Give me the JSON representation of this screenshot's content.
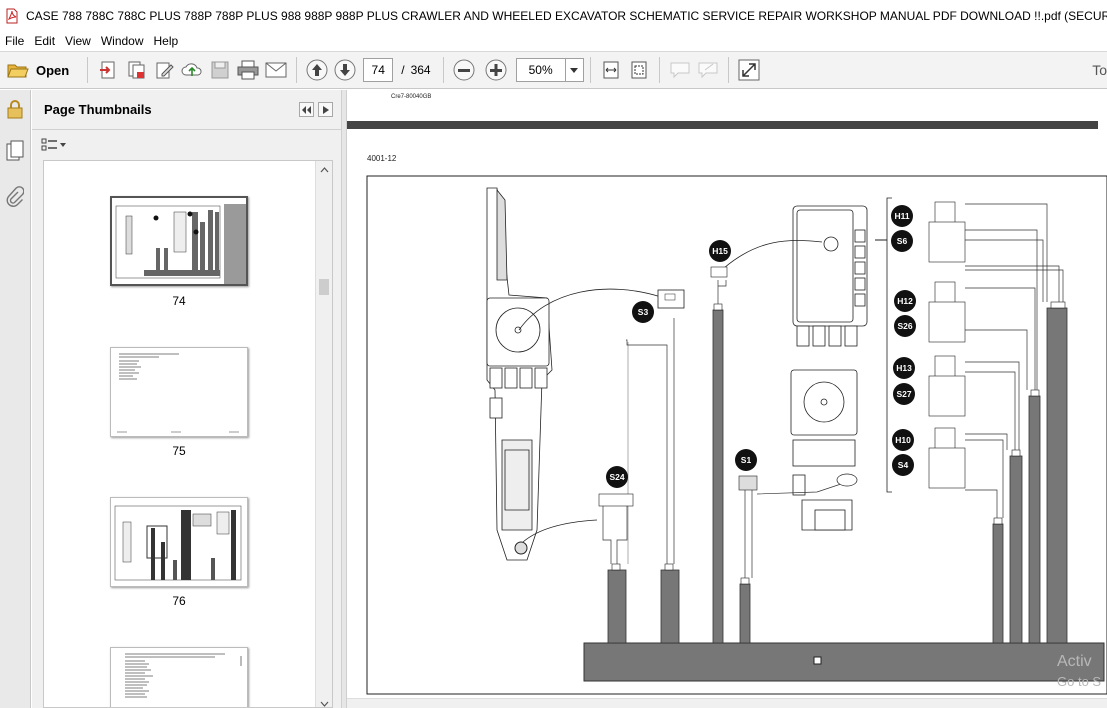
{
  "window": {
    "title": "CASE 788  788C  788C PLUS  788P  788P PLUS  988  988P  988P PLUS CRAWLER AND WHEELED EXCAVATOR SCHEMATIC SERVICE  REPAIR  WORKSHOP MANUAL  PDF DOWNLOAD !!.pdf (SECURED) - Adobe Re"
  },
  "menu": {
    "file": "File",
    "edit": "Edit",
    "view": "View",
    "window": "Window",
    "help": "Help"
  },
  "toolbar": {
    "open_label": "Open",
    "current_page": "74",
    "page_separator": "/",
    "total_pages": "364",
    "zoom": "50%",
    "tools_label": "To"
  },
  "thumbnails_panel": {
    "title": "Page Thumbnails",
    "thumbs": [
      {
        "label": "74"
      },
      {
        "label": "75"
      },
      {
        "label": "76"
      }
    ]
  },
  "document": {
    "header_code": "Cre7-80040GB",
    "section_code": "4001-12",
    "components": {
      "h11": "H11",
      "s6": "S6",
      "h12": "H12",
      "s26": "S26",
      "h13": "H13",
      "s27": "S27",
      "h10": "H10",
      "s4": "S4",
      "h15": "H15",
      "s3": "S3",
      "s24": "S24",
      "s1": "S1"
    }
  },
  "watermark": {
    "line1": "Activ",
    "line2": "Go to S"
  },
  "colors": {
    "accent": "#cc2222",
    "badge": "#111111",
    "bar": "#777777"
  }
}
